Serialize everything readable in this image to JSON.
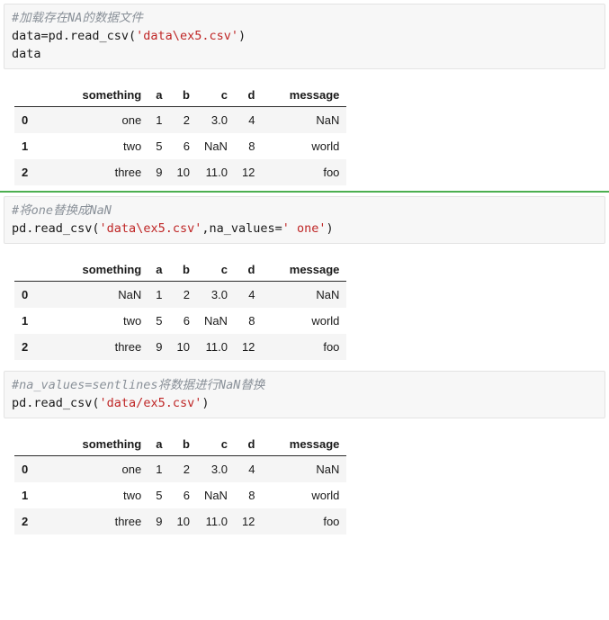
{
  "notebook": {
    "cells": [
      {
        "id": "cell-1",
        "selected": false,
        "comment": "#加载存在NA的数据文件",
        "code_parts": [
          {
            "text": "data=pd.read_csv(",
            "type": "plain"
          },
          {
            "text": "'data\\ex5.csv'",
            "type": "string"
          },
          {
            "text": ")",
            "type": "plain"
          }
        ],
        "code_line_1": "data=pd.read_csv('data\\ex5.csv')",
        "code_line_2": "data",
        "output": {
          "index_header": "",
          "columns": [
            "something",
            "a",
            "b",
            "c",
            "d",
            "message"
          ],
          "index": [
            "0",
            "1",
            "2"
          ],
          "rows": [
            [
              "one",
              "1",
              "2",
              "3.0",
              "4",
              "NaN"
            ],
            [
              "two",
              "5",
              "6",
              "NaN",
              "8",
              "world"
            ],
            [
              "three",
              "9",
              "10",
              "11.0",
              "12",
              "foo"
            ]
          ]
        }
      },
      {
        "id": "cell-2",
        "selected": true,
        "comment": "#将one替换成NaN",
        "code_line_1": "pd.read_csv('data\\ex5.csv',na_values=' one')",
        "output": {
          "index_header": "",
          "columns": [
            "something",
            "a",
            "b",
            "c",
            "d",
            "message"
          ],
          "index": [
            "0",
            "1",
            "2"
          ],
          "rows": [
            [
              "NaN",
              "1",
              "2",
              "3.0",
              "4",
              "NaN"
            ],
            [
              "two",
              "5",
              "6",
              "NaN",
              "8",
              "world"
            ],
            [
              "three",
              "9",
              "10",
              "11.0",
              "12",
              "foo"
            ]
          ]
        }
      },
      {
        "id": "cell-3",
        "selected": false,
        "comment": "#na_values=sentlines将数据进行NaN替换",
        "code_line_1": "pd.read_csv('data/ex5.csv')",
        "output": {
          "index_header": "",
          "columns": [
            "something",
            "a",
            "b",
            "c",
            "d",
            "message"
          ],
          "index": [
            "0",
            "1",
            "2"
          ],
          "rows": [
            [
              "one",
              "1",
              "2",
              "3.0",
              "4",
              "NaN"
            ],
            [
              "two",
              "5",
              "6",
              "NaN",
              "8",
              "world"
            ],
            [
              "three",
              "9",
              "10",
              "11.0",
              "12",
              "foo"
            ]
          ]
        }
      }
    ]
  },
  "colors": {
    "comment": "#8a9199",
    "string": "#bf2626",
    "code": "#1a1a1a",
    "cell_bg": "#f7f7f7",
    "cell_border": "#e3e3e3",
    "selected_marker": "#4caf50",
    "row_stripe": "#f5f5f5"
  }
}
